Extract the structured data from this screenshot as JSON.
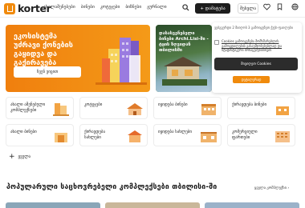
{
  "header": {
    "logo": "korter",
    "nav": [
      "ახალაშენებები",
      "ბინები",
      "კოტეჯები",
      "ბიზნესი",
      "ჟურნალი"
    ],
    "add_label": "+ დამატება",
    "login_label": "შესვლა"
  },
  "hero": {
    "title": "ეკოსისტემა უძრავი ქონების გაყიდვა და გაქირავება საქართველოში",
    "button": "ჩვენ ვიცით"
  },
  "promo": {
    "text": "დასასვენებელი ბინები Archi.Lisi-ში - ტყის ზღვიდან თბილისში"
  },
  "cookie": {
    "intro": "ვებგვერდი 2 მიიღოს 3 გამოიყენეთ ქუქი-ფაილები",
    "line1": "Cookies გამოიყენება მომხმარებლის",
    "line2": "გამოცდილების გასაუმჯობესებლად და",
    "line3": "სტატისტიკური მონაცემებისთვის",
    "accept": "მივიღეთ Cookies",
    "more": "დეტალურად"
  },
  "tiles": [
    {
      "label": "ახალი აშენებული კომპლექსები"
    },
    {
      "label": "კოტეჯები"
    },
    {
      "label": "იყიდება ბინები"
    },
    {
      "label": "ქირავდება ბინები"
    },
    {
      "label": "ახალი ბინები"
    },
    {
      "label": "ქირავდება სახლები"
    },
    {
      "label": "იყიდება სახლები"
    },
    {
      "label": "კომერციული ფართები"
    }
  ],
  "more_label": "ყველა",
  "section": {
    "title": "პოპულარული საცხოვრებელი კომპლექსები თბილისი-ში",
    "see_all": "ყველა კომპლექსი"
  }
}
